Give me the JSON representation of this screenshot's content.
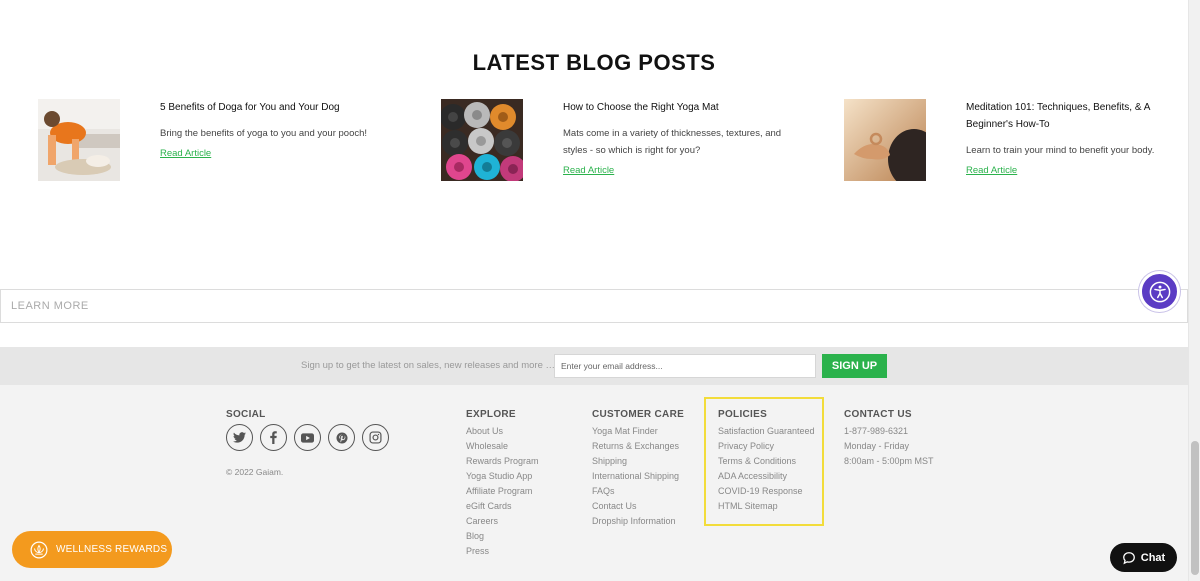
{
  "blog": {
    "title": "LATEST BLOG POSTS",
    "posts": [
      {
        "title": "5 Benefits of Doga for You and Your Dog",
        "desc": "Bring the benefits of yoga to you and your pooch!",
        "link": "Read Article"
      },
      {
        "title": "How to Choose the Right Yoga Mat",
        "desc": "Mats come in a variety of thicknesses, textures, and styles - so which is right for you?",
        "link": "Read Article"
      },
      {
        "title": "Meditation 101: Techniques, Benefits, & A Beginner's How-To",
        "desc": "Learn to train your mind to benefit your body.",
        "link": "Read Article"
      }
    ]
  },
  "learn_more": "LEARN MORE",
  "signup": {
    "text": "Sign up to get the latest on sales, new releases and more …",
    "placeholder": "Enter your email address...",
    "button": "SIGN UP"
  },
  "footer": {
    "social": {
      "heading": "SOCIAL",
      "icons": [
        "twitter-icon",
        "facebook-icon",
        "youtube-icon",
        "pinterest-icon",
        "instagram-icon"
      ],
      "copyright": "© 2022 Gaiam."
    },
    "explore": {
      "heading": "EXPLORE",
      "links": [
        "About Us",
        "Wholesale",
        "Rewards Program",
        "Yoga Studio App",
        "Affiliate Program",
        "eGift Cards",
        "Careers",
        "Blog",
        "Press"
      ]
    },
    "customer_care": {
      "heading": "CUSTOMER CARE",
      "links": [
        "Yoga Mat Finder",
        "Returns & Exchanges",
        "Shipping",
        "International Shipping",
        "FAQs",
        "Contact Us",
        "Dropship Information"
      ]
    },
    "policies": {
      "heading": "POLICIES",
      "links": [
        "Satisfaction Guaranteed",
        "Privacy Policy",
        "Terms & Conditions",
        "ADA Accessibility",
        "COVID-19 Response",
        "HTML Sitemap"
      ]
    },
    "contact": {
      "heading": "CONTACT US",
      "lines": [
        "1-877-989-6321",
        "Monday - Friday",
        "8:00am - 5:00pm MST"
      ]
    }
  },
  "rewards": "WELLNESS REWARDS",
  "chat": "Chat",
  "colors": {
    "accent_green": "#2bb24c",
    "rewards_orange": "#f39a1e",
    "highlight_yellow": "#f2dc3a",
    "accessibility_purple": "#5b3cc4"
  }
}
